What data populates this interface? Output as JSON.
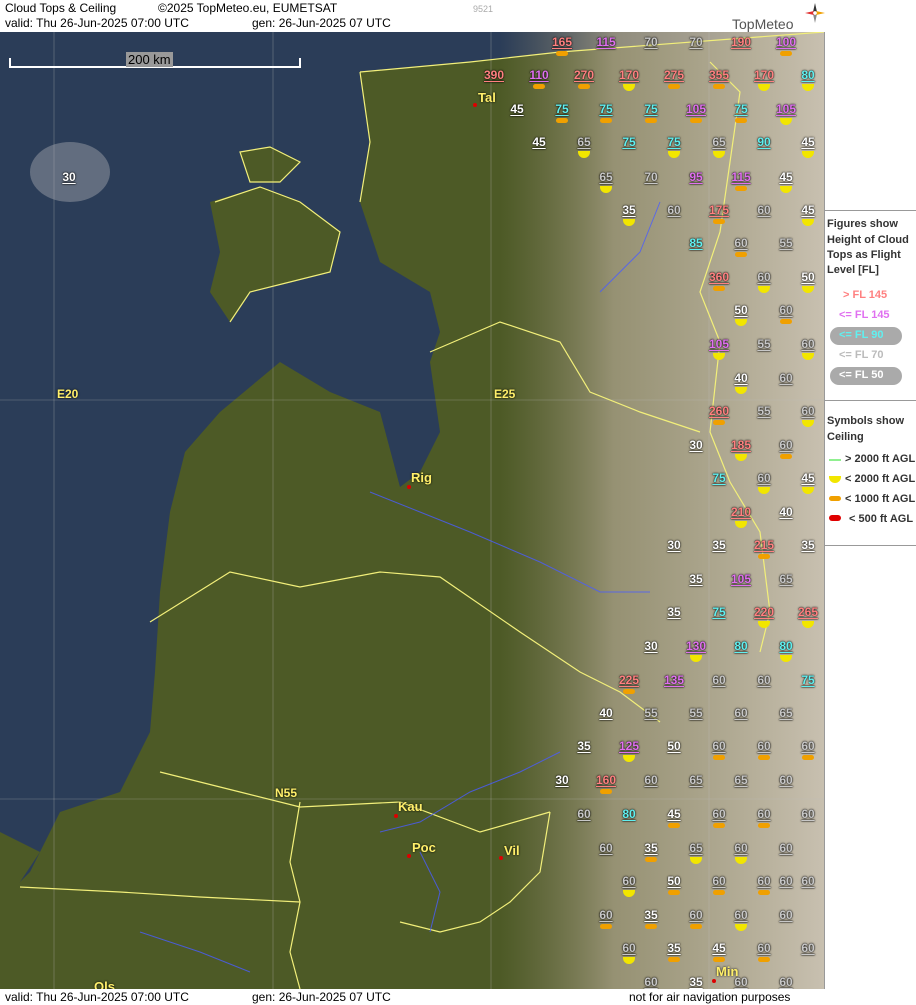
{
  "header": {
    "title": "Cloud Tops & Ceiling",
    "copyright": "©2025 TopMeteo.eu, EUMETSAT",
    "valid": "valid:  Thu  26-Jun-2025  07:00 UTC",
    "generated": "gen: 26-Jun-2025 07 UTC",
    "code": "9521",
    "brand": "TopMeteo"
  },
  "scale_label": "200 km",
  "grid_labels": {
    "e20": "E20",
    "e25": "E25",
    "n55": "N55"
  },
  "cities": {
    "tal": "Tal",
    "rig": "Rig",
    "kau": "Kau",
    "poc": "Poc",
    "vil": "Vil",
    "min": "Min",
    "ols": "Ols"
  },
  "station_values": [
    "165",
    "115",
    "70",
    "70",
    "190",
    "100",
    "390",
    "110",
    "270",
    "170",
    "275",
    "355",
    "170",
    "80",
    "45",
    "75",
    "75",
    "75",
    "105",
    "75",
    "105",
    "45",
    "65",
    "75",
    "75",
    "65",
    "90",
    "45",
    "30",
    "65",
    "70",
    "95",
    "115",
    "45",
    "35",
    "60",
    "175",
    "60",
    "45",
    "85",
    "60",
    "55",
    "360",
    "60",
    "50",
    "50",
    "60",
    "105",
    "55",
    "60",
    "40",
    "60",
    "260",
    "55",
    "60",
    "30",
    "185",
    "60",
    "75",
    "60",
    "45",
    "210",
    "40",
    "30",
    "35",
    "215",
    "35",
    "35",
    "105",
    "65",
    "35",
    "75",
    "220",
    "265",
    "30",
    "130",
    "80",
    "80",
    "225",
    "135",
    "60",
    "60",
    "75",
    "40",
    "55",
    "55",
    "60",
    "65",
    "35",
    "125",
    "50",
    "60",
    "60",
    "60",
    "30",
    "160",
    "60",
    "65",
    "65",
    "60",
    "60",
    "80",
    "45",
    "60",
    "60",
    "60",
    "60",
    "35",
    "65",
    "60",
    "60",
    "60",
    "60",
    "50",
    "60",
    "60",
    "60",
    "60",
    "35",
    "60",
    "60",
    "60",
    "60",
    "35",
    "45",
    "60",
    "60",
    "60",
    "35",
    "60",
    "60",
    "60"
  ],
  "sidebar": {
    "figures_title": [
      "Figures show",
      "Height of Cloud",
      "Tops as Flight",
      "Level  [FL]"
    ],
    "fl_legend": [
      "> FL 145",
      "<= FL 145",
      "<= FL 90",
      "<= FL 70",
      "<= FL 50"
    ],
    "symbols_title": [
      "Symbols show",
      "Ceiling"
    ],
    "ceiling_legend": [
      "> 2000 ft AGL",
      "< 2000 ft AGL",
      "< 1000 ft AGL",
      "< 500 ft AGL"
    ]
  },
  "footer": {
    "valid": "valid:  Thu  26-Jun-2025  07:00 UTC",
    "generated": "gen: 26-Jun-2025 07 UTC",
    "disclaimer": "not for air navigation purposes"
  },
  "colors": {
    "fl_gt145": "#ff8080",
    "fl_le145": "#e070f0",
    "fl_le90": "#60f0f0",
    "fl_le70": "#c8c8c8",
    "fl_le50": "#ffffff",
    "ceiling_gt2000": "#90f090",
    "ceiling_lt2000": "#f2e600",
    "ceiling_lt1000": "#f0a000",
    "ceiling_lt500": "#e00000",
    "sea": "#2b3d58",
    "land": "#4d5a26",
    "border": "#f2ef7a",
    "river": "#4a5cff"
  }
}
